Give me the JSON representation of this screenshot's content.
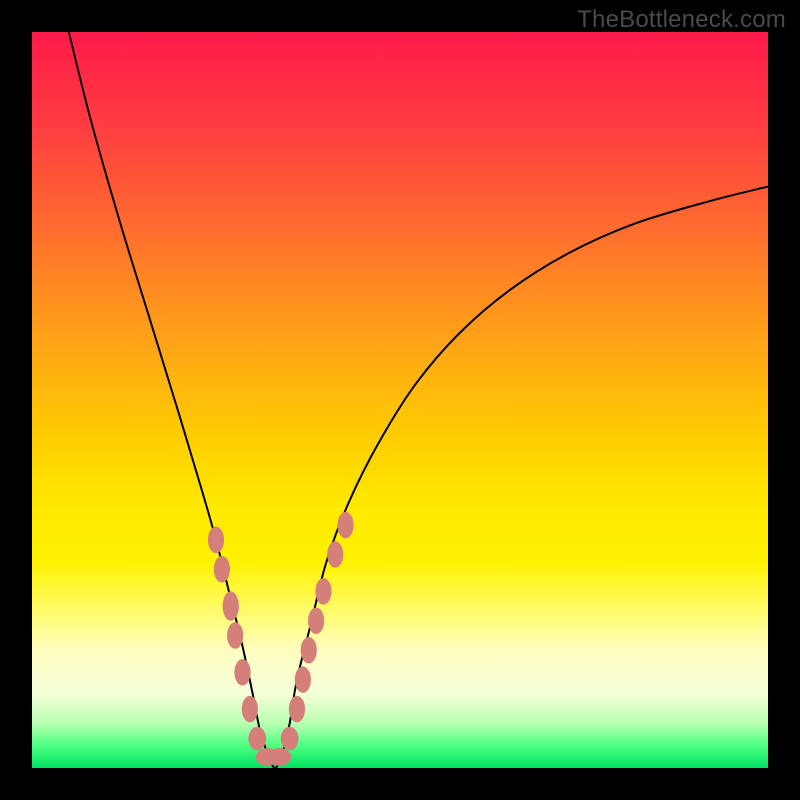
{
  "watermark": "TheBottleneck.com",
  "chart_data": {
    "type": "line",
    "title": "",
    "xlabel": "",
    "ylabel": "",
    "xlim": [
      0,
      100
    ],
    "ylim": [
      0,
      100
    ],
    "series": [
      {
        "name": "bottleneck-curve",
        "x": [
          5,
          8,
          12,
          16,
          20,
          23,
          25,
          27,
          28.5,
          30,
          31,
          32,
          33,
          34,
          35,
          36,
          38,
          40,
          43,
          47,
          52,
          58,
          65,
          73,
          82,
          92,
          100
        ],
        "y": [
          100,
          88,
          74,
          61,
          48,
          38,
          31,
          23,
          17,
          10,
          5,
          2,
          0,
          2,
          6,
          12,
          20,
          28,
          36,
          44,
          52,
          59,
          65,
          70,
          74,
          77,
          79
        ]
      }
    ],
    "markers": {
      "name": "highlight-points",
      "points": [
        {
          "x": 25.0,
          "y": 31,
          "rx": 1.1,
          "ry": 1.8
        },
        {
          "x": 25.8,
          "y": 27,
          "rx": 1.1,
          "ry": 1.8
        },
        {
          "x": 27.0,
          "y": 22,
          "rx": 1.1,
          "ry": 2.0
        },
        {
          "x": 27.6,
          "y": 18,
          "rx": 1.1,
          "ry": 1.8
        },
        {
          "x": 28.6,
          "y": 13,
          "rx": 1.1,
          "ry": 1.8
        },
        {
          "x": 29.6,
          "y": 8,
          "rx": 1.1,
          "ry": 1.8
        },
        {
          "x": 30.6,
          "y": 4,
          "rx": 1.2,
          "ry": 1.6
        },
        {
          "x": 32.0,
          "y": 1.5,
          "rx": 1.6,
          "ry": 1.2
        },
        {
          "x": 33.6,
          "y": 1.5,
          "rx": 1.6,
          "ry": 1.2
        },
        {
          "x": 35.0,
          "y": 4,
          "rx": 1.2,
          "ry": 1.6
        },
        {
          "x": 36.0,
          "y": 8,
          "rx": 1.1,
          "ry": 1.8
        },
        {
          "x": 36.8,
          "y": 12,
          "rx": 1.1,
          "ry": 1.8
        },
        {
          "x": 37.6,
          "y": 16,
          "rx": 1.1,
          "ry": 1.8
        },
        {
          "x": 38.6,
          "y": 20,
          "rx": 1.1,
          "ry": 1.8
        },
        {
          "x": 39.6,
          "y": 24,
          "rx": 1.1,
          "ry": 1.8
        },
        {
          "x": 41.2,
          "y": 29,
          "rx": 1.1,
          "ry": 1.8
        },
        {
          "x": 42.6,
          "y": 33,
          "rx": 1.1,
          "ry": 1.8
        }
      ]
    },
    "background_gradient": {
      "stops": [
        {
          "pos": 0.0,
          "color": "#ff1a4a"
        },
        {
          "pos": 0.36,
          "color": "#ff8e20"
        },
        {
          "pos": 0.64,
          "color": "#ffe800"
        },
        {
          "pos": 0.9,
          "color": "#f4ffd8"
        },
        {
          "pos": 1.0,
          "color": "#00e060"
        }
      ]
    }
  }
}
